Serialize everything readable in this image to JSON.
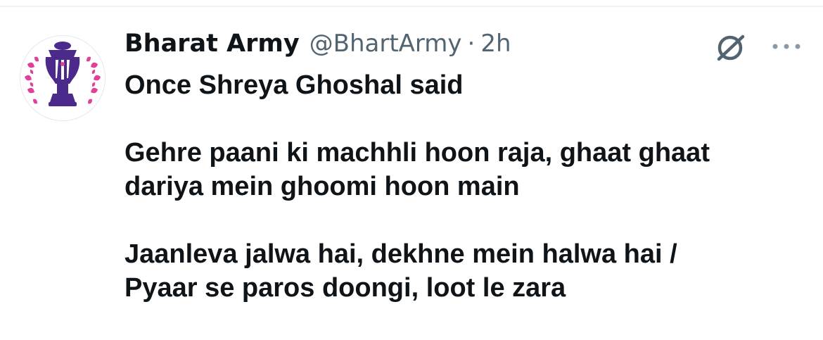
{
  "tweet": {
    "display_name": "Bharat Army",
    "handle": "@BhartArmy",
    "separator": "·",
    "timestamp": "2h",
    "text_lines": [
      "Once Shreya Ghoshal said",
      "",
      "Gehre paani ki machhli hoon raja, ghaat ghaat",
      "dariya mein ghoomi hoon main",
      "",
      "Jaanleva jalwa hai, dekhne mein halwa hai /",
      "Pyaar se paros doongi, loot le zara"
    ]
  },
  "icons": {
    "avatar": "world-cup-trophy-logo",
    "grok": "grok-icon",
    "more": "more-icon"
  },
  "colors": {
    "text": "#0f1419",
    "secondary": "#536471",
    "avatar_purple": "#4b2a8c",
    "avatar_pink": "#e0409a"
  }
}
